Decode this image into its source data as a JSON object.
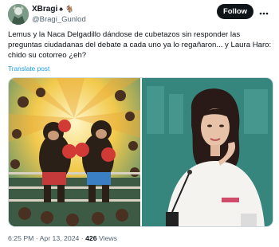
{
  "author": {
    "display_name": "XBragi",
    "name_emoji": "♠ 🐐",
    "handle": "@Bragi_Gunlod"
  },
  "follow_label": "Follow",
  "more_icon": "more-dots-icon",
  "tweet_text": "Lemus y la Naca Delgadillo dándose de cubetazos sin responder las preguntas ciudadanas del debate a cada uno ya lo regañaron... y Laura Haro: chido su cotorreo ¿eh?",
  "translate_label": "Translate post",
  "meta": {
    "time": "6:25 PM",
    "separator": " · ",
    "date": "Apr 13, 2024",
    "views_count": "426",
    "views_label": " Views"
  },
  "colors": {
    "accent": "#1d9bf0",
    "follow_bg": "#0f1419",
    "muted": "#536471"
  }
}
